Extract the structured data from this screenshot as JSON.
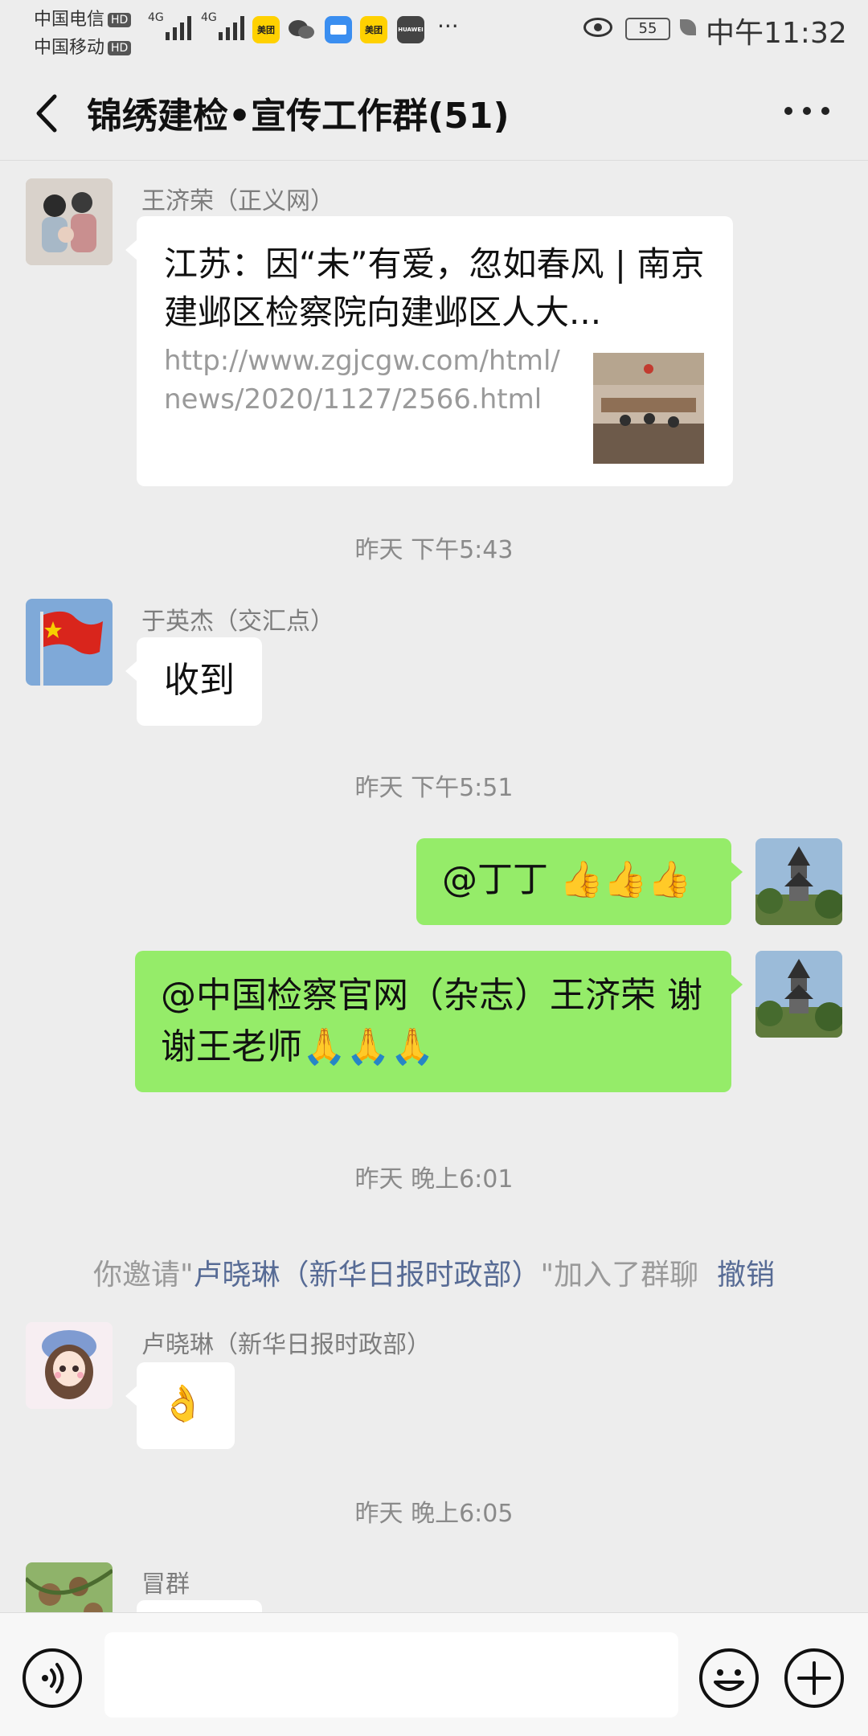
{
  "status_bar": {
    "carrier1": "中国电信",
    "carrier2": "中国移动",
    "hd": "HD",
    "net1": "4G",
    "net2": "4G",
    "app_meituan": "美团",
    "app_meituan2": "美团",
    "app_huawei": "HUAWEI",
    "more": "···",
    "battery": "55",
    "time": "中午11:32"
  },
  "nav": {
    "title": "锦绣建检•宣传工作群(51)"
  },
  "messages": {
    "m1": {
      "sender": "王济荣（正义网）",
      "link_title": "江苏：因“未”有爱，忽如春风 | 南京建邺区检察院向建邺区人大...",
      "link_url": "http://www.zgjcgw.com/html/news/2020/1127/2566.html"
    },
    "ts1": "昨天 下午5:43",
    "m2": {
      "sender": "于英杰（交汇点）",
      "text": "收到"
    },
    "ts2": "昨天 下午5:51",
    "m3": {
      "text": "@丁丁 👍👍👍"
    },
    "m4": {
      "text": "@中国检察官网（杂志）王济荣 谢谢王老师🙏🙏🙏"
    },
    "ts3": "昨天 晚上6:01",
    "sys": {
      "prefix": "你邀请\"",
      "name": "卢晓琳（新华日报时政部）",
      "suffix": "\"加入了群聊",
      "undo": "撤销"
    },
    "m5": {
      "sender": "卢晓琳（新华日报时政部）",
      "text": "👌"
    },
    "ts4": "昨天 晚上6:05",
    "m6": {
      "sender": "冒群"
    }
  },
  "colors": {
    "bubble_green": "#95ec69",
    "link_blue": "#576b95",
    "background": "#ededed"
  }
}
